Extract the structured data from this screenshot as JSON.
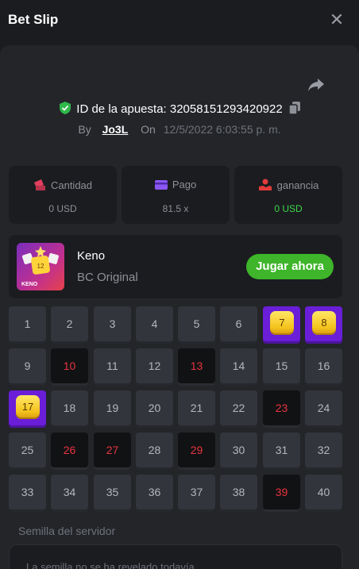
{
  "header": {
    "title": "Bet Slip"
  },
  "bet": {
    "id_label": "ID de la apuesta: 32058151293420922",
    "by_label": "By",
    "user": "Jo3L",
    "on_label": "On",
    "timestamp": "12/5/2022 6:03:55 p. m."
  },
  "stats": [
    {
      "label": "Cantidad",
      "value": "0 USD",
      "icon": "money-icon",
      "color": "#e2405e"
    },
    {
      "label": "Pago",
      "value": "81.5 x",
      "icon": "card-icon",
      "color": "#8a57f4"
    },
    {
      "label": "ganancia",
      "value": "0 USD",
      "icon": "hand-coin-icon",
      "color": "#e23b3b"
    }
  ],
  "game": {
    "name": "Keno",
    "provider": "BC Original",
    "play_label": "Jugar ahora",
    "thumb_text": "KENO",
    "thumb_tile": "12"
  },
  "keno": {
    "numbers": [
      1,
      2,
      3,
      4,
      5,
      6,
      7,
      8,
      9,
      10,
      11,
      12,
      13,
      14,
      15,
      16,
      17,
      18,
      19,
      20,
      21,
      22,
      23,
      24,
      25,
      26,
      27,
      28,
      29,
      30,
      31,
      32,
      33,
      34,
      35,
      36,
      37,
      38,
      39,
      40
    ],
    "hits": [
      7,
      8,
      17
    ],
    "misses": [
      10,
      13,
      23,
      26,
      27,
      29,
      39
    ]
  },
  "seed": {
    "label": "Semilla del servidor",
    "value": "La semilla no se ha revelado todavía"
  },
  "colors": {
    "accent_green": "#3eb52a",
    "hit_purple": "#6a1ed8",
    "miss_red": "#e8343f"
  }
}
